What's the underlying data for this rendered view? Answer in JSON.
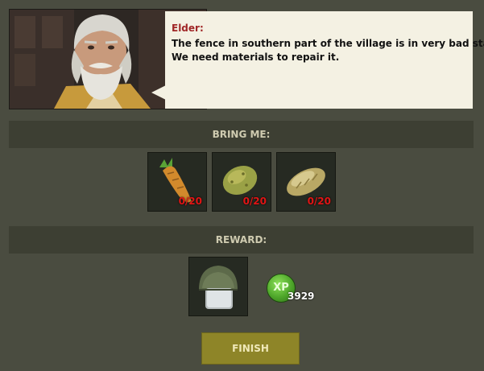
{
  "dialog": {
    "speaker": "Elder:",
    "lines": [
      "The fence in southern part of the village is in very bad state.",
      "We need materials to repair it."
    ]
  },
  "bring": {
    "title": "BRING ME:",
    "items": [
      {
        "icon": "carrot-icon",
        "count": "0/20"
      },
      {
        "icon": "potato-icon",
        "count": "0/20"
      },
      {
        "icon": "bread-loaf-icon",
        "count": "0/20"
      }
    ]
  },
  "reward": {
    "title": "REWARD:",
    "item_icon": "military-helmet-icon",
    "xp_label": "XP",
    "xp_value": "3929"
  },
  "finish_label": "FINISH",
  "colors": {
    "background": "#4a4c40",
    "section_bar": "#3d3f33",
    "speech_bg": "#f4f1e3",
    "speaker_name": "#a02727",
    "count_red": "#e01515",
    "xp_green": "#4ea62a",
    "finish_button": "#8e8528"
  }
}
